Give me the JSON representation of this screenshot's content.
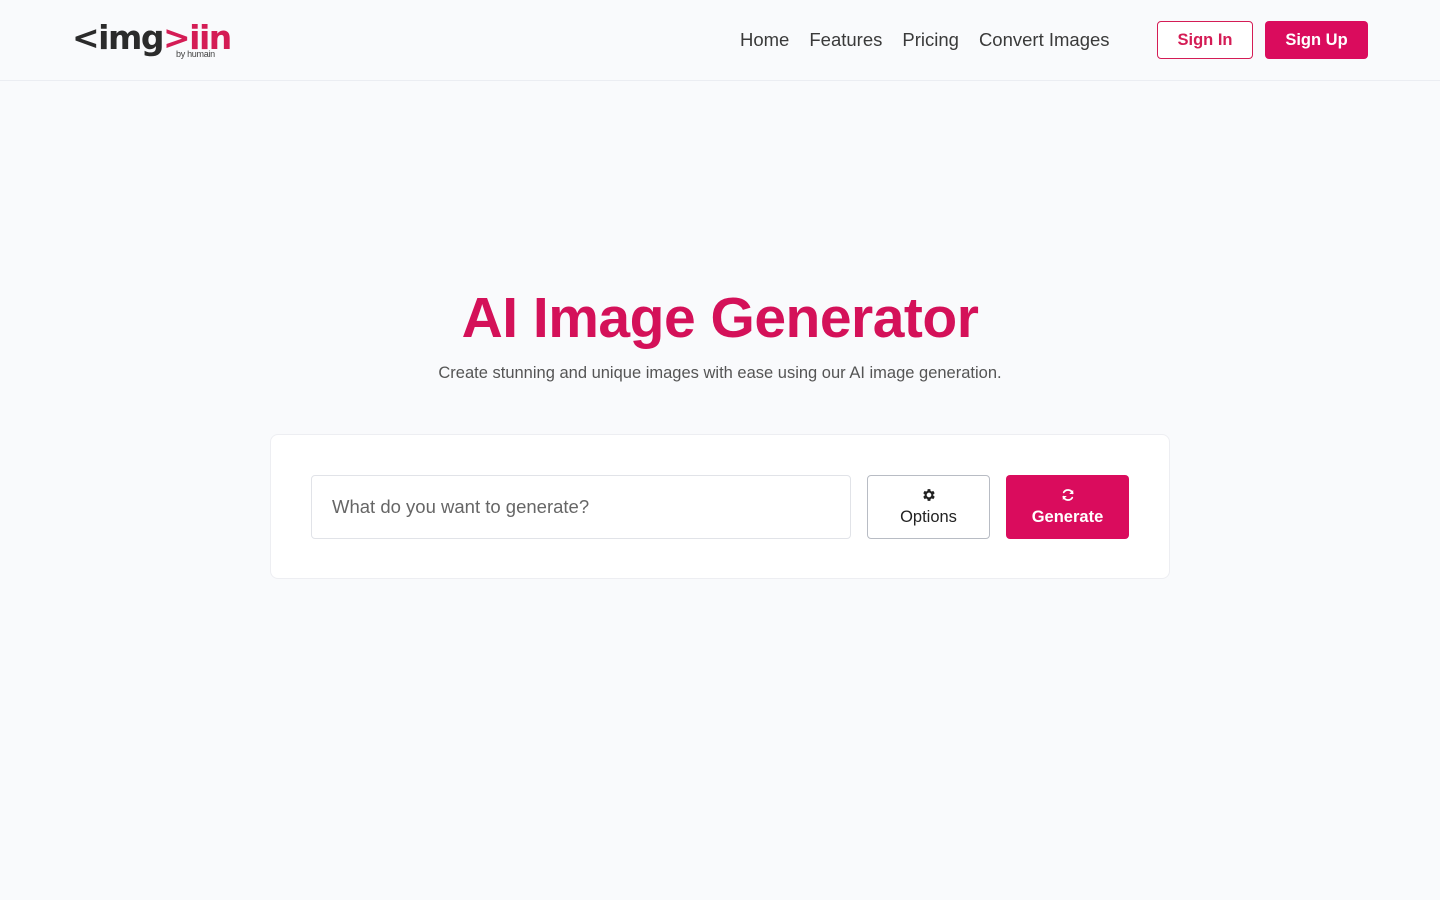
{
  "header": {
    "logo": {
      "part1": "<img",
      "part2": ">iin",
      "sub": "by humain"
    },
    "nav": [
      {
        "label": "Home"
      },
      {
        "label": "Features"
      },
      {
        "label": "Pricing"
      },
      {
        "label": "Convert Images"
      }
    ],
    "sign_in_label": "Sign In",
    "sign_up_label": "Sign Up"
  },
  "hero": {
    "title": "AI Image Generator",
    "subtitle": "Create stunning and unique images with ease using our AI image generation."
  },
  "generator": {
    "prompt_placeholder": "What do you want to generate?",
    "prompt_value": "",
    "options_label": "Options",
    "options_icon": "gear-icon",
    "generate_label": "Generate",
    "generate_icon": "refresh-icon"
  },
  "colors": {
    "accent": "#da0c5d",
    "title": "#d41159",
    "background": "#f9fafc"
  }
}
